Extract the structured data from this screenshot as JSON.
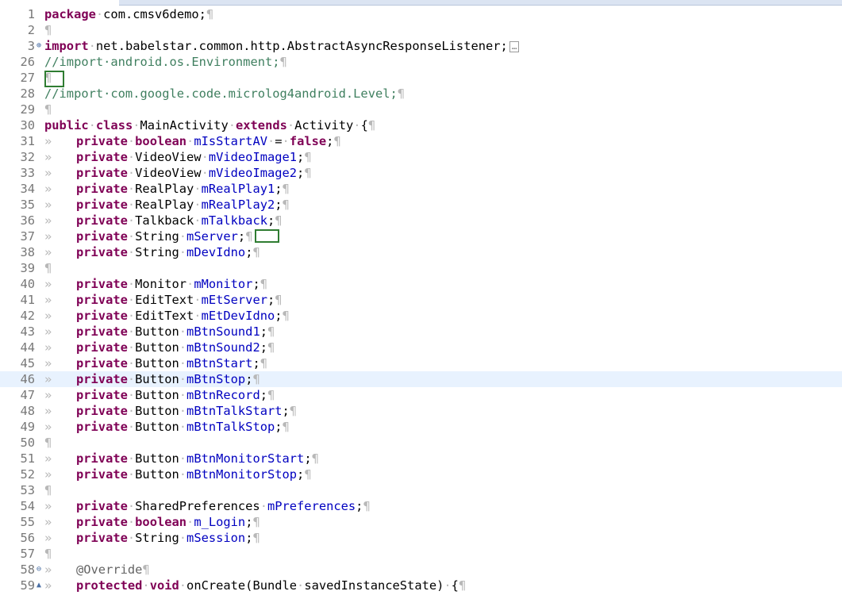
{
  "theme": {
    "keyword_color": "#7f0055",
    "field_color": "#0000c0",
    "comment_color": "#3f7f5f",
    "annotation_color": "#646464",
    "whitespace_color": "#b8b8b8",
    "current_line_bg": "#e8f2fe",
    "highlight_box_color": "#2f7d32"
  },
  "editor": {
    "lines": [
      {
        "num": "1",
        "tokens": [
          {
            "t": "kw",
            "v": "package"
          },
          {
            "t": "ws",
            "v": "·"
          },
          {
            "t": "p",
            "v": "com.cmsv6demo;"
          },
          {
            "t": "pil",
            "v": "¶"
          }
        ]
      },
      {
        "num": "2",
        "tokens": [
          {
            "t": "pil",
            "v": "¶"
          }
        ]
      },
      {
        "num": "3",
        "fold": "plus",
        "tokens": [
          {
            "t": "kw",
            "v": "import"
          },
          {
            "t": "ws",
            "v": "·"
          },
          {
            "t": "p",
            "v": "net.babelstar.common.http.AbstractAsyncResponseListener;"
          },
          {
            "t": "collapsed",
            "v": "…"
          }
        ]
      },
      {
        "num": "26",
        "tokens": [
          {
            "t": "cm",
            "v": "//import·android.os.Environment;"
          },
          {
            "t": "pil",
            "v": "¶"
          }
        ]
      },
      {
        "num": "27",
        "tokens": [
          {
            "t": "pil",
            "v": "¶"
          }
        ]
      },
      {
        "num": "28",
        "tokens": [
          {
            "t": "cm",
            "v": "//import·com.google.code.microlog4android.Level;"
          },
          {
            "t": "pil",
            "v": "¶"
          }
        ]
      },
      {
        "num": "29",
        "tokens": [
          {
            "t": "pil",
            "v": "¶"
          }
        ]
      },
      {
        "num": "30",
        "tokens": [
          {
            "t": "kw",
            "v": "public"
          },
          {
            "t": "ws",
            "v": "·"
          },
          {
            "t": "kw",
            "v": "class"
          },
          {
            "t": "ws",
            "v": "·"
          },
          {
            "t": "p",
            "v": "MainActivity"
          },
          {
            "t": "ws",
            "v": "·"
          },
          {
            "t": "kw",
            "v": "extends"
          },
          {
            "t": "ws",
            "v": "·"
          },
          {
            "t": "p",
            "v": "Activity"
          },
          {
            "t": "ws",
            "v": "·"
          },
          {
            "t": "p",
            "v": "{"
          },
          {
            "t": "pil",
            "v": "¶"
          }
        ]
      },
      {
        "num": "31",
        "tokens": [
          {
            "t": "tab",
            "v": "»"
          },
          {
            "t": "kw",
            "v": "private"
          },
          {
            "t": "ws",
            "v": "·"
          },
          {
            "t": "kw",
            "v": "boolean"
          },
          {
            "t": "ws",
            "v": "·"
          },
          {
            "t": "fld",
            "v": "mIsStartAV"
          },
          {
            "t": "ws",
            "v": "·"
          },
          {
            "t": "p",
            "v": "="
          },
          {
            "t": "ws",
            "v": "·"
          },
          {
            "t": "kw",
            "v": "false"
          },
          {
            "t": "p",
            "v": ";"
          },
          {
            "t": "pil",
            "v": "¶"
          }
        ]
      },
      {
        "num": "32",
        "tokens": [
          {
            "t": "tab",
            "v": "»"
          },
          {
            "t": "kw",
            "v": "private"
          },
          {
            "t": "ws",
            "v": "·"
          },
          {
            "t": "p",
            "v": "VideoView"
          },
          {
            "t": "ws",
            "v": "·"
          },
          {
            "t": "fld",
            "v": "mVideoImage1"
          },
          {
            "t": "p",
            "v": ";"
          },
          {
            "t": "pil",
            "v": "¶"
          }
        ]
      },
      {
        "num": "33",
        "tokens": [
          {
            "t": "tab",
            "v": "»"
          },
          {
            "t": "kw",
            "v": "private"
          },
          {
            "t": "ws",
            "v": "·"
          },
          {
            "t": "p",
            "v": "VideoView"
          },
          {
            "t": "ws",
            "v": "·"
          },
          {
            "t": "fld",
            "v": "mVideoImage2"
          },
          {
            "t": "p",
            "v": ";"
          },
          {
            "t": "pil",
            "v": "¶"
          }
        ]
      },
      {
        "num": "34",
        "tokens": [
          {
            "t": "tab",
            "v": "»"
          },
          {
            "t": "kw",
            "v": "private"
          },
          {
            "t": "ws",
            "v": "·"
          },
          {
            "t": "p",
            "v": "RealPlay"
          },
          {
            "t": "ws",
            "v": "·"
          },
          {
            "t": "fld",
            "v": "mRealPlay1"
          },
          {
            "t": "p",
            "v": ";"
          },
          {
            "t": "pil",
            "v": "¶"
          }
        ]
      },
      {
        "num": "35",
        "tokens": [
          {
            "t": "tab",
            "v": "»"
          },
          {
            "t": "kw",
            "v": "private"
          },
          {
            "t": "ws",
            "v": "·"
          },
          {
            "t": "p",
            "v": "RealPlay"
          },
          {
            "t": "ws",
            "v": "·"
          },
          {
            "t": "fld",
            "v": "mRealPlay2"
          },
          {
            "t": "p",
            "v": ";"
          },
          {
            "t": "pil",
            "v": "¶"
          }
        ]
      },
      {
        "num": "36",
        "tokens": [
          {
            "t": "tab",
            "v": "»"
          },
          {
            "t": "kw",
            "v": "private"
          },
          {
            "t": "ws",
            "v": "·"
          },
          {
            "t": "p",
            "v": "Talkback"
          },
          {
            "t": "ws",
            "v": "·"
          },
          {
            "t": "fld",
            "v": "mTalkback"
          },
          {
            "t": "p",
            "v": ";"
          },
          {
            "t": "pil",
            "v": "¶"
          }
        ]
      },
      {
        "num": "37",
        "tokens": [
          {
            "t": "tab",
            "v": "»"
          },
          {
            "t": "kw",
            "v": "private"
          },
          {
            "t": "ws",
            "v": "·"
          },
          {
            "t": "p",
            "v": "String"
          },
          {
            "t": "ws",
            "v": "·"
          },
          {
            "t": "fld",
            "v": "mServer"
          },
          {
            "t": "p",
            "v": ";"
          },
          {
            "t": "pil",
            "v": "¶"
          }
        ]
      },
      {
        "num": "38",
        "tokens": [
          {
            "t": "tab",
            "v": "»"
          },
          {
            "t": "kw",
            "v": "private"
          },
          {
            "t": "ws",
            "v": "·"
          },
          {
            "t": "p",
            "v": "String"
          },
          {
            "t": "ws",
            "v": "·"
          },
          {
            "t": "fld",
            "v": "mDevIdno"
          },
          {
            "t": "p",
            "v": ";"
          },
          {
            "t": "pil",
            "v": "¶"
          }
        ]
      },
      {
        "num": "39",
        "tokens": [
          {
            "t": "pil",
            "v": "¶"
          }
        ]
      },
      {
        "num": "40",
        "tokens": [
          {
            "t": "tab",
            "v": "»"
          },
          {
            "t": "kw",
            "v": "private"
          },
          {
            "t": "ws",
            "v": "·"
          },
          {
            "t": "p",
            "v": "Monitor"
          },
          {
            "t": "ws",
            "v": "·"
          },
          {
            "t": "fld",
            "v": "mMonitor"
          },
          {
            "t": "p",
            "v": ";"
          },
          {
            "t": "pil",
            "v": "¶"
          }
        ]
      },
      {
        "num": "41",
        "tokens": [
          {
            "t": "tab",
            "v": "»"
          },
          {
            "t": "kw",
            "v": "private"
          },
          {
            "t": "ws",
            "v": "·"
          },
          {
            "t": "p",
            "v": "EditText"
          },
          {
            "t": "ws",
            "v": "·"
          },
          {
            "t": "fld",
            "v": "mEtServer"
          },
          {
            "t": "p",
            "v": ";"
          },
          {
            "t": "pil",
            "v": "¶"
          }
        ]
      },
      {
        "num": "42",
        "tokens": [
          {
            "t": "tab",
            "v": "»"
          },
          {
            "t": "kw",
            "v": "private"
          },
          {
            "t": "ws",
            "v": "·"
          },
          {
            "t": "p",
            "v": "EditText"
          },
          {
            "t": "ws",
            "v": "·"
          },
          {
            "t": "fld",
            "v": "mEtDevIdno"
          },
          {
            "t": "p",
            "v": ";"
          },
          {
            "t": "pil",
            "v": "¶"
          }
        ]
      },
      {
        "num": "43",
        "tokens": [
          {
            "t": "tab",
            "v": "»"
          },
          {
            "t": "kw",
            "v": "private"
          },
          {
            "t": "ws",
            "v": "·"
          },
          {
            "t": "p",
            "v": "Button"
          },
          {
            "t": "ws",
            "v": "·"
          },
          {
            "t": "fld",
            "v": "mBtnSound1"
          },
          {
            "t": "p",
            "v": ";"
          },
          {
            "t": "pil",
            "v": "¶"
          }
        ]
      },
      {
        "num": "44",
        "tokens": [
          {
            "t": "tab",
            "v": "»"
          },
          {
            "t": "kw",
            "v": "private"
          },
          {
            "t": "ws",
            "v": "·"
          },
          {
            "t": "p",
            "v": "Button"
          },
          {
            "t": "ws",
            "v": "·"
          },
          {
            "t": "fld",
            "v": "mBtnSound2"
          },
          {
            "t": "p",
            "v": ";"
          },
          {
            "t": "pil",
            "v": "¶"
          }
        ]
      },
      {
        "num": "45",
        "tokens": [
          {
            "t": "tab",
            "v": "»"
          },
          {
            "t": "kw",
            "v": "private"
          },
          {
            "t": "ws",
            "v": "·"
          },
          {
            "t": "p",
            "v": "Button"
          },
          {
            "t": "ws",
            "v": "·"
          },
          {
            "t": "fld",
            "v": "mBtnStart"
          },
          {
            "t": "p",
            "v": ";"
          },
          {
            "t": "pil",
            "v": "¶"
          }
        ]
      },
      {
        "num": "46",
        "current": true,
        "tokens": [
          {
            "t": "tab",
            "v": "»"
          },
          {
            "t": "kw",
            "v": "private"
          },
          {
            "t": "ws",
            "v": "·"
          },
          {
            "t": "p",
            "v": "Button"
          },
          {
            "t": "ws",
            "v": "·"
          },
          {
            "t": "fld",
            "v": "mBtnStop"
          },
          {
            "t": "p",
            "v": ";"
          },
          {
            "t": "pil",
            "v": "¶"
          }
        ]
      },
      {
        "num": "47",
        "tokens": [
          {
            "t": "tab",
            "v": "»"
          },
          {
            "t": "kw",
            "v": "private"
          },
          {
            "t": "ws",
            "v": "·"
          },
          {
            "t": "p",
            "v": "Button"
          },
          {
            "t": "ws",
            "v": "·"
          },
          {
            "t": "fld",
            "v": "mBtnRecord"
          },
          {
            "t": "p",
            "v": ";"
          },
          {
            "t": "pil",
            "v": "¶"
          }
        ]
      },
      {
        "num": "48",
        "tokens": [
          {
            "t": "tab",
            "v": "»"
          },
          {
            "t": "kw",
            "v": "private"
          },
          {
            "t": "ws",
            "v": "·"
          },
          {
            "t": "p",
            "v": "Button"
          },
          {
            "t": "ws",
            "v": "·"
          },
          {
            "t": "fld",
            "v": "mBtnTalkStart"
          },
          {
            "t": "p",
            "v": ";"
          },
          {
            "t": "pil",
            "v": "¶"
          }
        ]
      },
      {
        "num": "49",
        "tokens": [
          {
            "t": "tab",
            "v": "»"
          },
          {
            "t": "kw",
            "v": "private"
          },
          {
            "t": "ws",
            "v": "·"
          },
          {
            "t": "p",
            "v": "Button"
          },
          {
            "t": "ws",
            "v": "·"
          },
          {
            "t": "fld",
            "v": "mBtnTalkStop"
          },
          {
            "t": "p",
            "v": ";"
          },
          {
            "t": "pil",
            "v": "¶"
          }
        ]
      },
      {
        "num": "50",
        "tokens": [
          {
            "t": "pil",
            "v": "¶"
          }
        ]
      },
      {
        "num": "51",
        "tokens": [
          {
            "t": "tab",
            "v": "»"
          },
          {
            "t": "kw",
            "v": "private"
          },
          {
            "t": "ws",
            "v": "·"
          },
          {
            "t": "p",
            "v": "Button"
          },
          {
            "t": "ws",
            "v": "·"
          },
          {
            "t": "fld",
            "v": "mBtnMonitorStart"
          },
          {
            "t": "p",
            "v": ";"
          },
          {
            "t": "pil",
            "v": "¶"
          }
        ]
      },
      {
        "num": "52",
        "tokens": [
          {
            "t": "tab",
            "v": "»"
          },
          {
            "t": "kw",
            "v": "private"
          },
          {
            "t": "ws",
            "v": "·"
          },
          {
            "t": "p",
            "v": "Button"
          },
          {
            "t": "ws",
            "v": "·"
          },
          {
            "t": "fld",
            "v": "mBtnMonitorStop"
          },
          {
            "t": "p",
            "v": ";"
          },
          {
            "t": "pil",
            "v": "¶"
          }
        ]
      },
      {
        "num": "53",
        "tokens": [
          {
            "t": "pil",
            "v": "¶"
          }
        ]
      },
      {
        "num": "54",
        "tokens": [
          {
            "t": "tab",
            "v": "»"
          },
          {
            "t": "kw",
            "v": "private"
          },
          {
            "t": "ws",
            "v": "·"
          },
          {
            "t": "p",
            "v": "SharedPreferences"
          },
          {
            "t": "ws",
            "v": "·"
          },
          {
            "t": "fld",
            "v": "mPreferences"
          },
          {
            "t": "p",
            "v": ";"
          },
          {
            "t": "pil",
            "v": "¶"
          }
        ]
      },
      {
        "num": "55",
        "tokens": [
          {
            "t": "tab",
            "v": "»"
          },
          {
            "t": "kw",
            "v": "private"
          },
          {
            "t": "ws",
            "v": "·"
          },
          {
            "t": "kw",
            "v": "boolean"
          },
          {
            "t": "ws",
            "v": "·"
          },
          {
            "t": "fld",
            "v": "m_Login"
          },
          {
            "t": "p",
            "v": ";"
          },
          {
            "t": "pil",
            "v": "¶"
          }
        ]
      },
      {
        "num": "56",
        "tokens": [
          {
            "t": "tab",
            "v": "»"
          },
          {
            "t": "kw",
            "v": "private"
          },
          {
            "t": "ws",
            "v": "·"
          },
          {
            "t": "p",
            "v": "String"
          },
          {
            "t": "ws",
            "v": "·"
          },
          {
            "t": "fld",
            "v": "mSession"
          },
          {
            "t": "p",
            "v": ";"
          },
          {
            "t": "pil",
            "v": "¶"
          }
        ]
      },
      {
        "num": "57",
        "tokens": [
          {
            "t": "pil",
            "v": "¶"
          }
        ]
      },
      {
        "num": "58",
        "fold": "minus",
        "tokens": [
          {
            "t": "tab",
            "v": "»"
          },
          {
            "t": "ann",
            "v": "@Override"
          },
          {
            "t": "pil",
            "v": "¶"
          }
        ]
      },
      {
        "num": "59",
        "fold": "up",
        "tokens": [
          {
            "t": "tab",
            "v": "»"
          },
          {
            "t": "kw",
            "v": "protected"
          },
          {
            "t": "ws",
            "v": "·"
          },
          {
            "t": "kw",
            "v": "void"
          },
          {
            "t": "ws",
            "v": "·"
          },
          {
            "t": "p",
            "v": "onCreate(Bundle"
          },
          {
            "t": "ws",
            "v": "·"
          },
          {
            "t": "p",
            "v": "savedInstanceState)"
          },
          {
            "t": "ws",
            "v": "·"
          },
          {
            "t": "p",
            "v": "{"
          },
          {
            "t": "pil",
            "v": "¶"
          }
        ]
      }
    ]
  }
}
